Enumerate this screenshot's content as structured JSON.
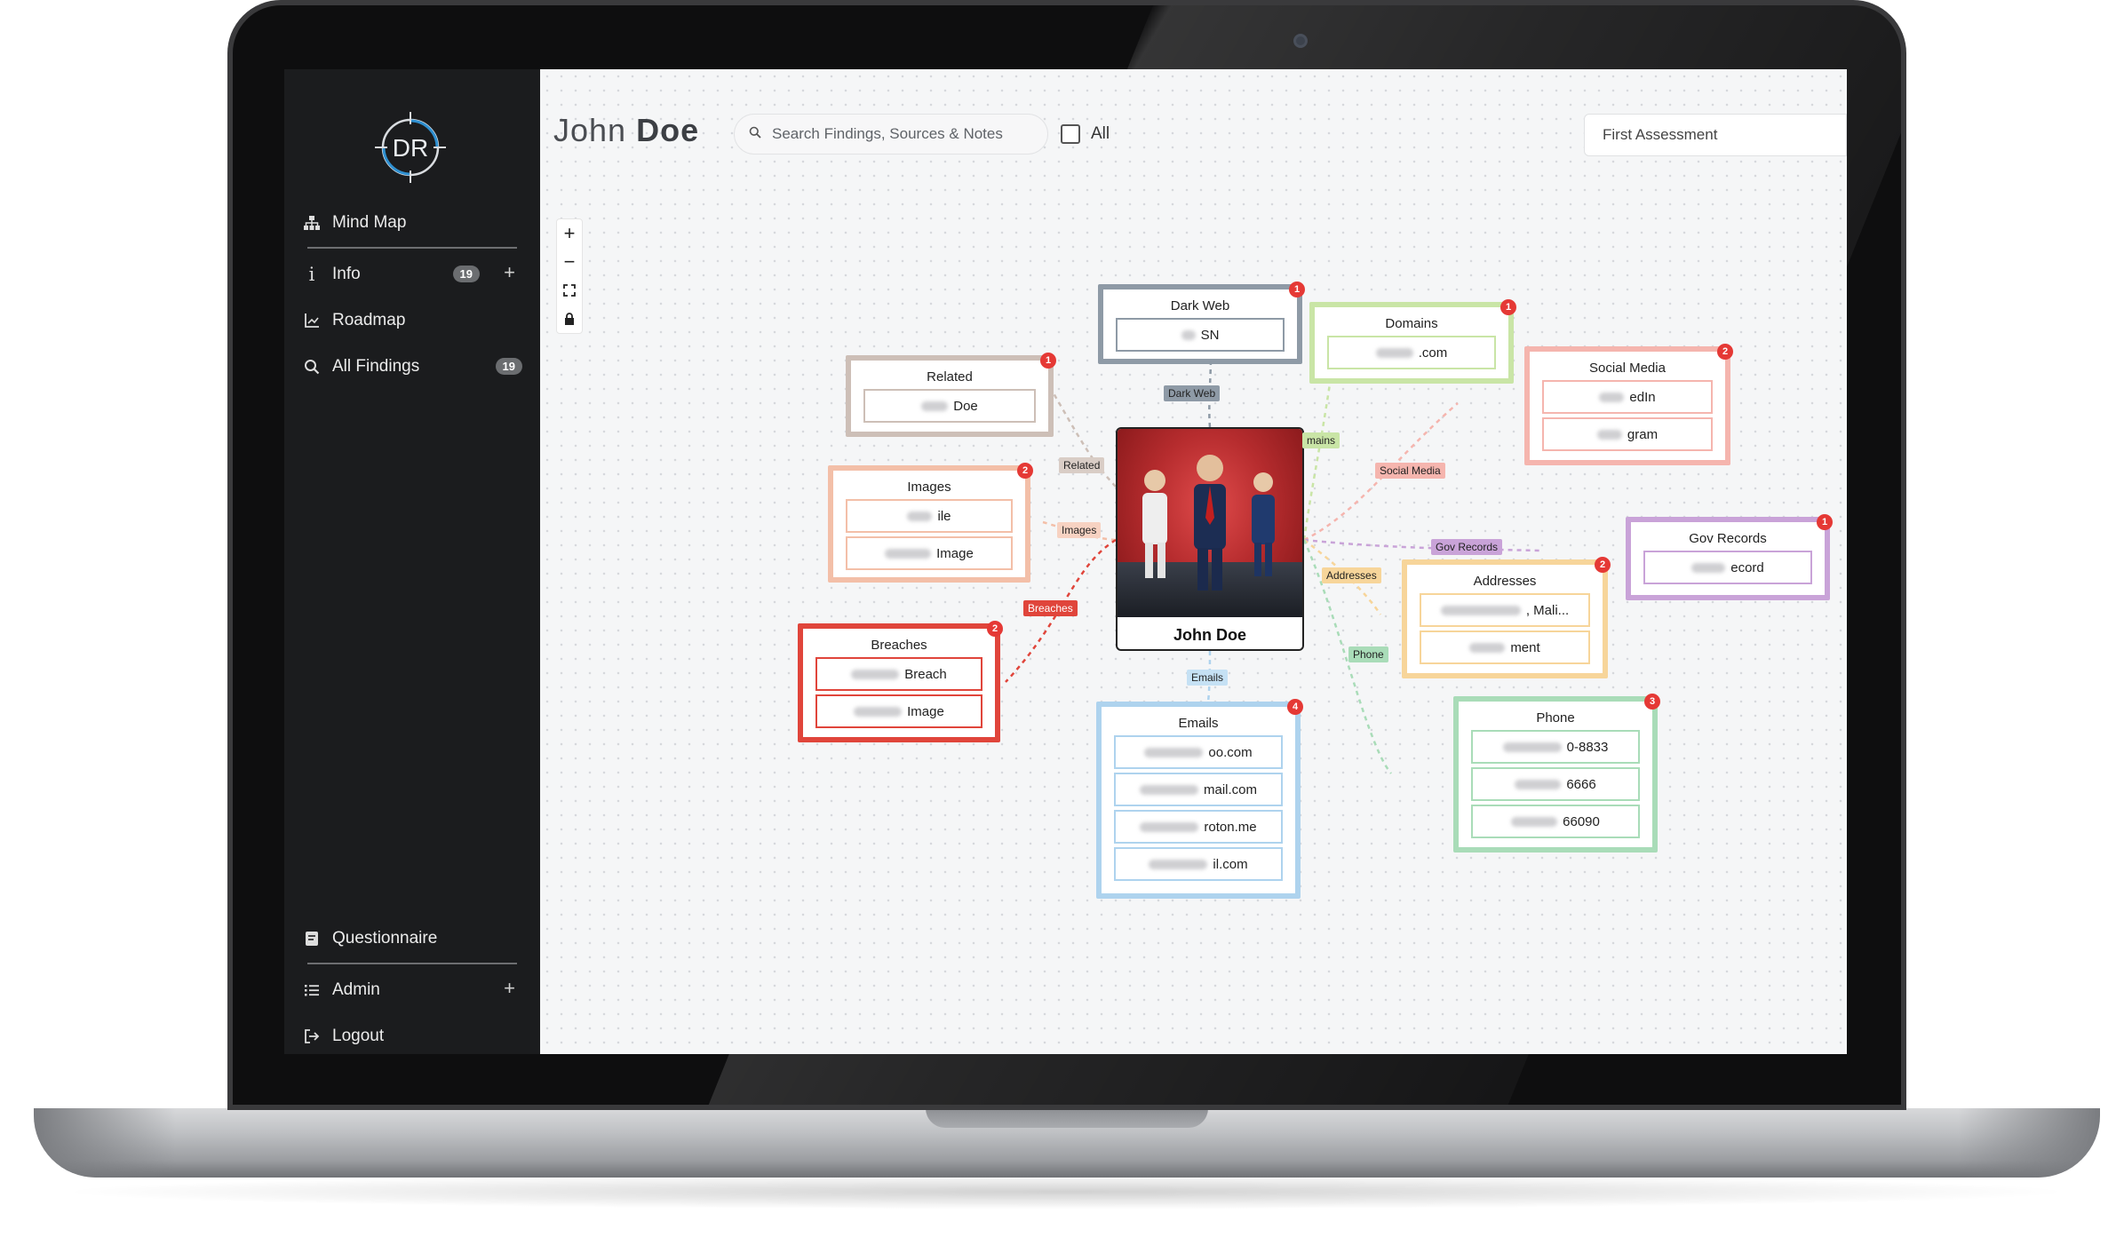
{
  "app": {
    "logo_text": "DR",
    "person_first": "John",
    "person_last": "Doe"
  },
  "sidebar": {
    "items": [
      {
        "label": "Mind Map",
        "icon": "sitemap-icon"
      },
      {
        "label": "Info",
        "icon": "info-icon",
        "badge": "19",
        "plus": "+"
      },
      {
        "label": "Roadmap",
        "icon": "chart-icon"
      },
      {
        "label": "All Findings",
        "icon": "search-icon",
        "badge": "19"
      },
      {
        "label": "Questionnaire",
        "icon": "form-icon"
      },
      {
        "label": "Admin",
        "icon": "list-icon",
        "plus": "+"
      },
      {
        "label": "Logout",
        "icon": "logout-icon"
      }
    ]
  },
  "topbar": {
    "search_placeholder": "Search Findings, Sources & Notes",
    "all_label": "All",
    "assessment": "First Assessment"
  },
  "zoom_controls": [
    "+",
    "−",
    "⛶",
    "🔒"
  ],
  "mindmap": {
    "center": {
      "name": "John Doe"
    },
    "nodes": {
      "darkweb": {
        "title": "Dark Web",
        "count": "1",
        "rows": [
          "SN"
        ],
        "edge": "Dark Web",
        "color": "#8e9aa6"
      },
      "related": {
        "title": "Related",
        "count": "1",
        "rows": [
          "Doe"
        ],
        "edge": "Related",
        "color": "#cdbfb7"
      },
      "images": {
        "title": "Images",
        "count": "2",
        "rows": [
          "ile",
          "Image"
        ],
        "edge": "Images",
        "color": "#f3bfa8"
      },
      "breaches": {
        "title": "Breaches",
        "count": "2",
        "rows": [
          "Breach",
          "Image"
        ],
        "edge": "Breaches",
        "color": "#e0453b"
      },
      "emails": {
        "title": "Emails",
        "count": "4",
        "rows": [
          "oo.com",
          "mail.com",
          "roton.me",
          "il.com"
        ],
        "edge": "Emails",
        "color": "#aed3ee"
      },
      "domains": {
        "title": "Domains",
        "count": "1",
        "rows": [
          ".com"
        ],
        "edge": "mains",
        "color": "#c9e5a6"
      },
      "social": {
        "title": "Social Media",
        "count": "2",
        "rows": [
          "edIn",
          "gram"
        ],
        "edge": "Social Media",
        "color": "#f5b5ae"
      },
      "gov": {
        "title": "Gov Records",
        "count": "1",
        "rows": [
          "ecord"
        ],
        "edge": "Gov Records",
        "color": "#c9a3d8"
      },
      "addresses": {
        "title": "Addresses",
        "count": "2",
        "rows": [
          ", Mali...",
          "ment"
        ],
        "edge": "Addresses",
        "color": "#f7d59a"
      },
      "phone": {
        "title": "Phone",
        "count": "3",
        "rows": [
          "0-8833",
          "6666",
          "66090"
        ],
        "edge": "Phone",
        "color": "#a9dcb8"
      }
    }
  }
}
